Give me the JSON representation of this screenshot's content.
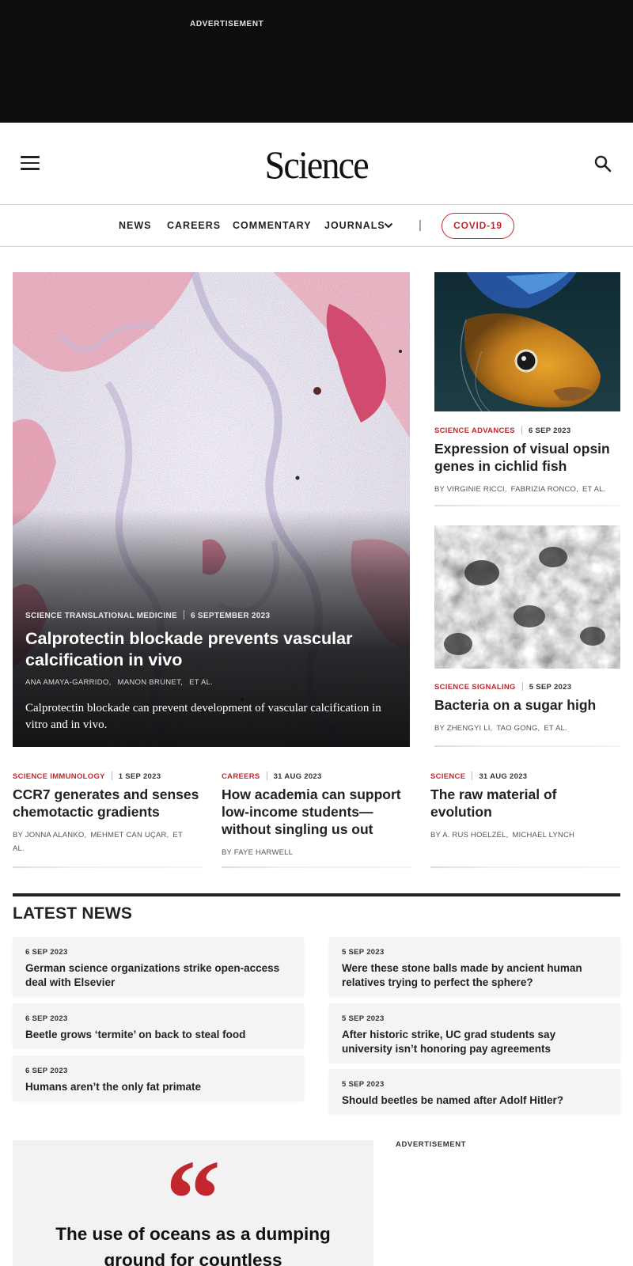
{
  "ad_top": {
    "label": "ADVERTISEMENT"
  },
  "header": {
    "logo": "Science"
  },
  "nav": {
    "items": [
      "NEWS",
      "CAREERS",
      "COMMENTARY",
      "JOURNALS"
    ],
    "separator": "|",
    "covid": "COVID-19"
  },
  "hero": {
    "journal": "SCIENCE TRANSLATIONAL MEDICINE",
    "date": "6 SEPTEMBER 2023",
    "title": "Calprotectin blockade prevents vascular calcification in vivo",
    "authors": [
      "ANA AMAYA-GARRIDO,",
      "MANON BRUNET,",
      "ET AL."
    ],
    "description": "Calprotectin blockade can prevent development of vascular calcification in vitro and in vivo."
  },
  "side_cards": [
    {
      "journal": "SCIENCE ADVANCES",
      "date": "6 SEP 2023",
      "title": "Expression of visual opsin genes in cichlid fish",
      "authors": [
        "BY VIRGINIE RICCI,",
        "FABRIZIA RONCO,",
        "ET AL."
      ]
    },
    {
      "journal": "SCIENCE SIGNALING",
      "date": "5 SEP 2023",
      "title": "Bacteria on a sugar high",
      "authors": [
        "BY ZHENGYI LI,",
        "TAO GONG,",
        "ET AL."
      ]
    }
  ],
  "bottom_cards": [
    {
      "journal": "SCIENCE IMMUNOLOGY",
      "date": "1 SEP 2023",
      "title": "CCR7 generates and senses chemotactic gradients",
      "authors": [
        "BY JONNA ALANKO,",
        "MEHMET CAN UÇAR,",
        "ET AL."
      ]
    },
    {
      "journal": "CAREERS",
      "date": "31 AUG 2023",
      "title": "How academia can support low-income students—without singling us out",
      "authors": [
        "BY FAYE HARWELL"
      ]
    },
    {
      "journal": "SCIENCE",
      "date": "31 AUG 2023",
      "title": "The raw material of evolution",
      "authors": [
        "BY A. RUS HOELZEL,",
        "MICHAEL LYNCH"
      ]
    }
  ],
  "latest_news": {
    "title": "LATEST NEWS",
    "left": [
      {
        "date": "6 SEP 2023",
        "headline": "German science organizations strike open-access deal with Elsevier"
      },
      {
        "date": "6 SEP 2023",
        "headline": "Beetle grows ‘termite’ on back to steal food"
      },
      {
        "date": "6 SEP 2023",
        "headline": "Humans aren’t the only fat primate"
      }
    ],
    "right": [
      {
        "date": "5 SEP 2023",
        "headline": "Were these stone balls made by ancient human relatives trying to perfect the sphere?"
      },
      {
        "date": "5 SEP 2023",
        "headline": "After historic strike, UC grad students say university isn’t honoring pay agreements"
      },
      {
        "date": "5 SEP 2023",
        "headline": "Should beetles be named after Adolf Hitler?"
      }
    ]
  },
  "quote": {
    "mark": "“",
    "text": "The use of oceans as a dumping ground for countless"
  },
  "ad_side": {
    "label": "ADVERTISEMENT"
  },
  "colors": {
    "accent": "#c1272d",
    "ad_bg": "#0d0d0f",
    "card_bg": "#f4f4f4"
  }
}
